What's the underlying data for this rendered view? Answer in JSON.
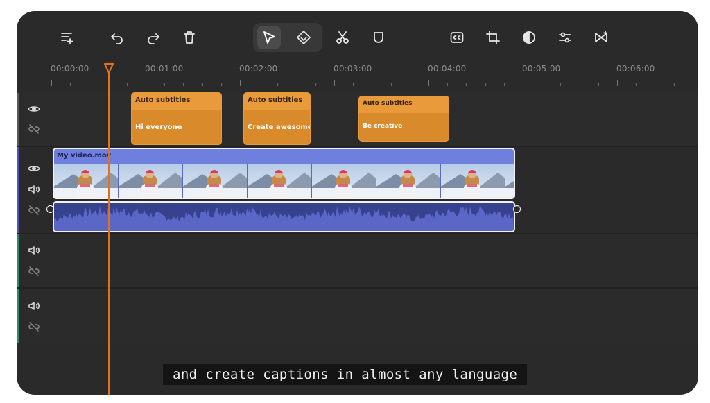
{
  "toolbar": {
    "left": [
      "add-track-icon",
      "undo-icon",
      "redo-icon",
      "delete-icon"
    ],
    "tools": [
      "select-arrow-icon",
      "pin-icon"
    ],
    "middle": [
      "cut-icon",
      "shield-icon"
    ],
    "right": [
      "captions-icon",
      "crop-icon",
      "filter-icon",
      "adjust-icon",
      "transition-icon"
    ]
  },
  "ruler": {
    "labels": [
      "00:00:00",
      "00:01:00",
      "00:02:00",
      "00:03:00",
      "00:04:00",
      "00:05:00",
      "00:06:00"
    ]
  },
  "subtitle_clips": [
    {
      "header": "Auto subtitles",
      "text": "Hi everyone"
    },
    {
      "header": "Auto subtitles",
      "text": "Create awesome c"
    },
    {
      "header": "Auto subtitles",
      "text": "Be creative"
    }
  ],
  "video_clip": {
    "name": "My video.mov"
  },
  "caption": {
    "text": "and create captions in almost any language"
  },
  "colors": {
    "accent_orange": "#e3701d",
    "subtitle_clip": "#d98b2c",
    "video_clip": "#6f7fdd",
    "audio_clip": "#37428f",
    "track_stripe_subtitle": "#5a5a5a",
    "track_stripe_video": "#4a55b8",
    "track_stripe_audio": "#2f8a6a"
  }
}
